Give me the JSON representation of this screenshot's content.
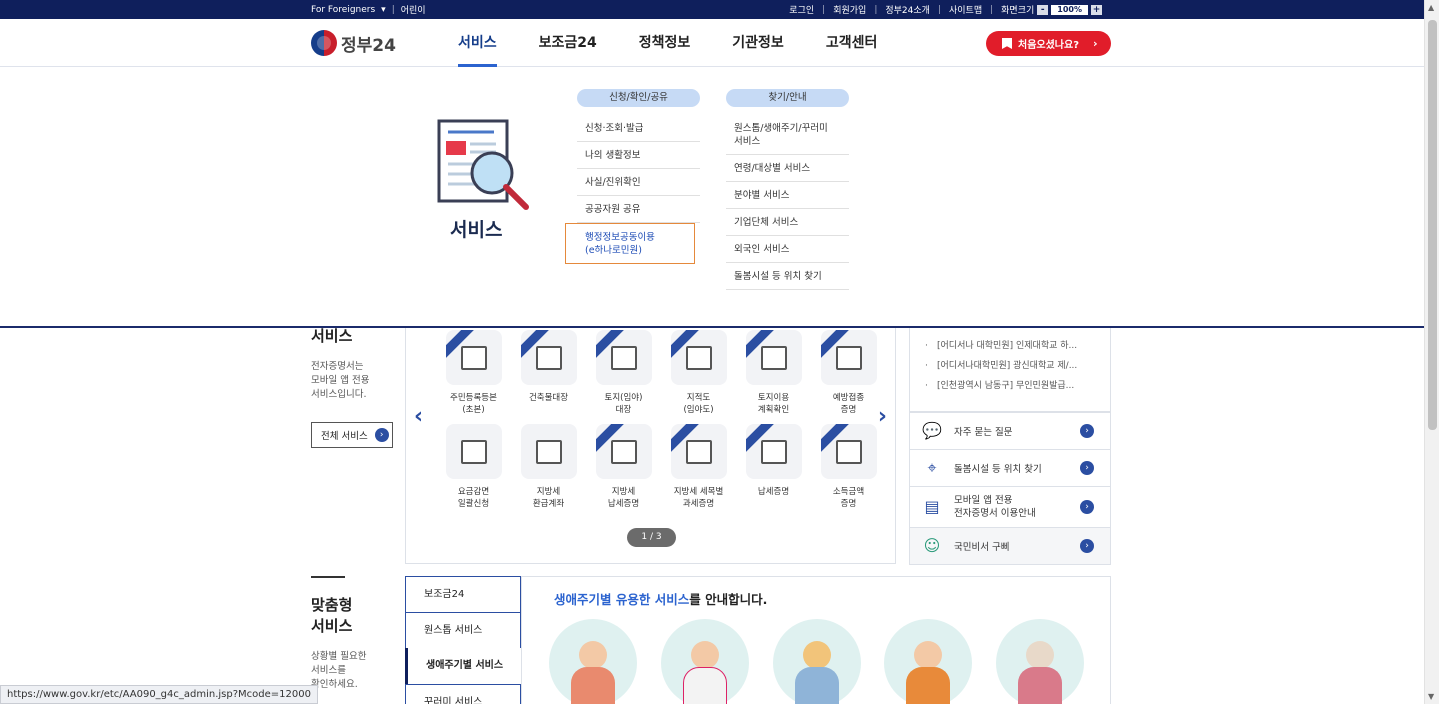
{
  "util": {
    "foreigners": "For Foreigners",
    "kids": "어린이",
    "login": "로그인",
    "join": "회원가입",
    "about": "정부24소개",
    "sitemap": "사이트맵",
    "zoom_label": "화면크기",
    "zoom_minus": "-",
    "zoom_value": "100%",
    "zoom_plus": "+"
  },
  "header": {
    "logo": "정부24",
    "nav": [
      "서비스",
      "보조금24",
      "정책정보",
      "기관정보",
      "고객센터"
    ],
    "first_visit": "처음오셨나요?"
  },
  "mega": {
    "title": "서비스",
    "col1": {
      "category": "신청/확인/공유",
      "links": [
        "신청·조회·발급",
        "나의 생활정보",
        "사실/진위확인",
        "공공자원 공유"
      ],
      "highlight": "행정정보공동이용\n(e하나로민원)"
    },
    "col2": {
      "category": "찾기/안내",
      "links": [
        "원스톱/생애주기/꾸러미\n서비스",
        "연령/대상별 서비스",
        "분야별 서비스",
        "기업단체 서비스",
        "외국인 서비스",
        "돌봄시설 등 위치 찾기"
      ]
    }
  },
  "services": {
    "side_title": "서비스",
    "side_desc": "전자증명서는\n모바일 앱 전용\n서비스입니다.",
    "all_button": "전체 서비스",
    "items": [
      {
        "label": "주민등록등본\n(초본)",
        "ribbon": true
      },
      {
        "label": "건축물대장",
        "ribbon": true
      },
      {
        "label": "토지(임야)\n대장",
        "ribbon": true
      },
      {
        "label": "지적도\n(임야도)",
        "ribbon": true
      },
      {
        "label": "토지이용\n계획확인",
        "ribbon": true
      },
      {
        "label": "예방접종\n증명",
        "ribbon": true
      },
      {
        "label": "요금감면\n일괄신청",
        "ribbon": false
      },
      {
        "label": "지방세\n환급계좌",
        "ribbon": false
      },
      {
        "label": "지방세\n납세증명",
        "ribbon": true
      },
      {
        "label": "지방세 세목별\n과세증명",
        "ribbon": true
      },
      {
        "label": "납세증명",
        "ribbon": true
      },
      {
        "label": "소득금액\n증명",
        "ribbon": true
      }
    ],
    "pager": "1 / 3"
  },
  "notices": [
    "[어디서나 대학민원] 인제대학교 하...",
    "[어디서나대학민원] 광신대학교 제/...",
    "[인천광역시 남동구] 무인민원발급..."
  ],
  "quick_links": [
    {
      "label": "자주 묻는 질문",
      "icon": "chat-icon"
    },
    {
      "label": "돌봄시설 등 위치 찾기",
      "icon": "map-pin-icon"
    },
    {
      "label": "모바일 앱 전용\n전자증명서 이용안내",
      "icon": "document-icon"
    },
    {
      "label": "국민비서 구삐",
      "icon": "robot-icon"
    }
  ],
  "custom": {
    "title": "맞춤형\n서비스",
    "desc": "상황별 필요한\n서비스를\n확인하세요.",
    "tabs": [
      "보조금24",
      "원스톱 서비스",
      "생애주기별 서비스",
      "꾸러미 서비스"
    ],
    "panel_heading_blue": "생애주기별 유용한 서비스",
    "panel_heading_rest": "를 안내합니다."
  },
  "status_url": "https://www.gov.kr/etc/AA090_g4c_admin.jsp?Mcode=12000",
  "colors": {
    "navy": "#0f1f5c",
    "accent_blue": "#2b63cf",
    "red_button": "#e11d2a",
    "highlight_border": "#e5893b"
  }
}
